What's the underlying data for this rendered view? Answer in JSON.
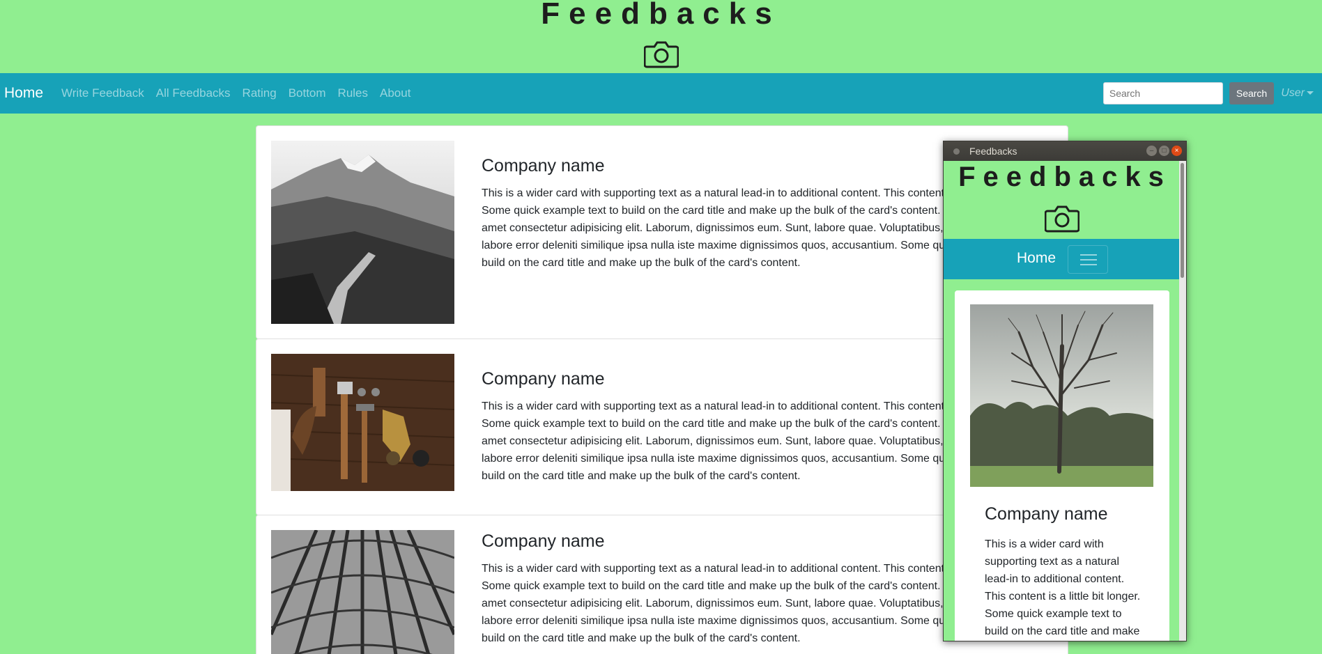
{
  "site": {
    "title": "Feedbacks",
    "camera_icon": "camera-icon"
  },
  "navbar": {
    "brand": "Home",
    "links": [
      "Write Feedback",
      "All Feedbacks",
      "Rating",
      "Bottom",
      "Rules",
      "About"
    ],
    "search_placeholder": "Search",
    "search_button": "Search",
    "user_menu": "User",
    "bg_color": "#17a2b8"
  },
  "cards": [
    {
      "title": "Company name",
      "text": "This is a wider card with supporting text as a natural lead-in to additional content. This content is a little bit longer. Some quick example text to build on the card title and make up the bulk of the card's content. Lorem ipsum dolor, sit amet consectetur adipisicing elit. Laborum, dignissimos eum. Sunt, labore quae. Voluptatibus, excepturi soluta alias, labore error deleniti similique ipsa nulla iste maxime dignissimos quos, accusantium. Some quick example text to build on the card title and make up the bulk of the card's content.",
      "image": "mountain-photo"
    },
    {
      "title": "Company name",
      "text": "This is a wider card with supporting text as a natural lead-in to additional content. This content is a little bit longer. Some quick example text to build on the card title and make up the bulk of the card's content. Lorem ipsum dolor, sit amet consectetur adipisicing elit. Laborum, dignissimos eum. Sunt, labore quae. Voluptatibus, excepturi soluta alias, labore error deleniti similique ipsa nulla iste maxime dignissimos quos, accusantium. Some quick example text to build on the card title and make up the bulk of the card's content.",
      "image": "tools-photo"
    },
    {
      "title": "Company name",
      "text": "This is a wider card with supporting text as a natural lead-in to additional content. This content is a little bit longer. Some quick example text to build on the card title and make up the bulk of the card's content. Lorem ipsum dolor, sit amet consectetur adipisicing elit. Laborum, dignissimos eum. Sunt, labore quae. Voluptatibus, excepturi soluta alias, labore error deleniti similique ipsa nulla iste maxime dignissimos quos, accusantium. Some quick example text to build on the card title and make up the bulk of the card's content.",
      "image": "station-roof-photo"
    }
  ],
  "window": {
    "title": "Feedbacks",
    "site_title": "Feedbacks",
    "nav_brand": "Home",
    "card_title": "Company name",
    "card_text": "This is a wider card with supporting text as a natural lead-in to additional content. This content is a little bit longer. Some quick example text to build on the card title and make up the bulk of the card's content.",
    "card_image": "tree-photo"
  }
}
